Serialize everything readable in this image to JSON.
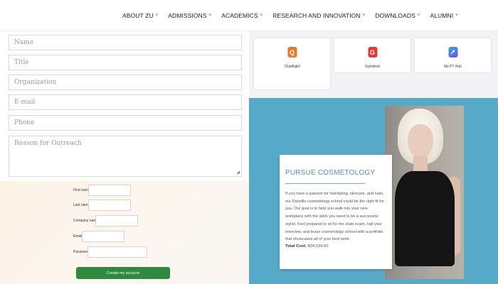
{
  "nav": {
    "items": [
      {
        "label": "ABOUT ZU"
      },
      {
        "label": "ADMISSIONS"
      },
      {
        "label": "ACADEMICS"
      },
      {
        "label": "RESEARCH AND INNOVATION"
      },
      {
        "label": "DOWNLOADS"
      },
      {
        "label": "ALUMNI"
      }
    ],
    "chevron": "˅"
  },
  "outreach_form": {
    "placeholders": {
      "name": "Name",
      "title": "Title",
      "organization": "Organization",
      "email": "E-mail",
      "phone": "Phone",
      "reason": "Reason for Outreach"
    }
  },
  "signup": {
    "first_name_label": "First name",
    "last_name_label": "Last name",
    "company_label": "Company name",
    "email_label": "Email",
    "password_label": "Password",
    "button_label": "Create my account",
    "button_color": "#2e8a3e"
  },
  "apps": [
    {
      "name": "ClubRight",
      "icon_letter": "Q",
      "icon": "clubright-icon",
      "color": "#e8772e"
    },
    {
      "name": "Gymdesk",
      "icon_letter": "G",
      "icon": "gymdesk-icon",
      "color": "#e53935"
    },
    {
      "name": "My PT Hub",
      "icon_letter": "➚",
      "icon": "my-pt-hub-icon",
      "color": "#7b4fe0"
    }
  ],
  "cosmetology": {
    "title": "PURSUE COSMETOLOGY",
    "body": "If you have a passion for hairstyling, skincare, and nails, our Danville cosmetology school could be the right fit for you. Our goal is to help you walk into your new workplace with the skills you need to be a successful stylist. Feel prepared to sit for the state exam, nail your interview, and leave cosmetology school with a portfolio that showcases all of your best work.",
    "cost_label": "Total Cost:",
    "cost_value": "$34,534.00",
    "background": "#56a9c7"
  }
}
